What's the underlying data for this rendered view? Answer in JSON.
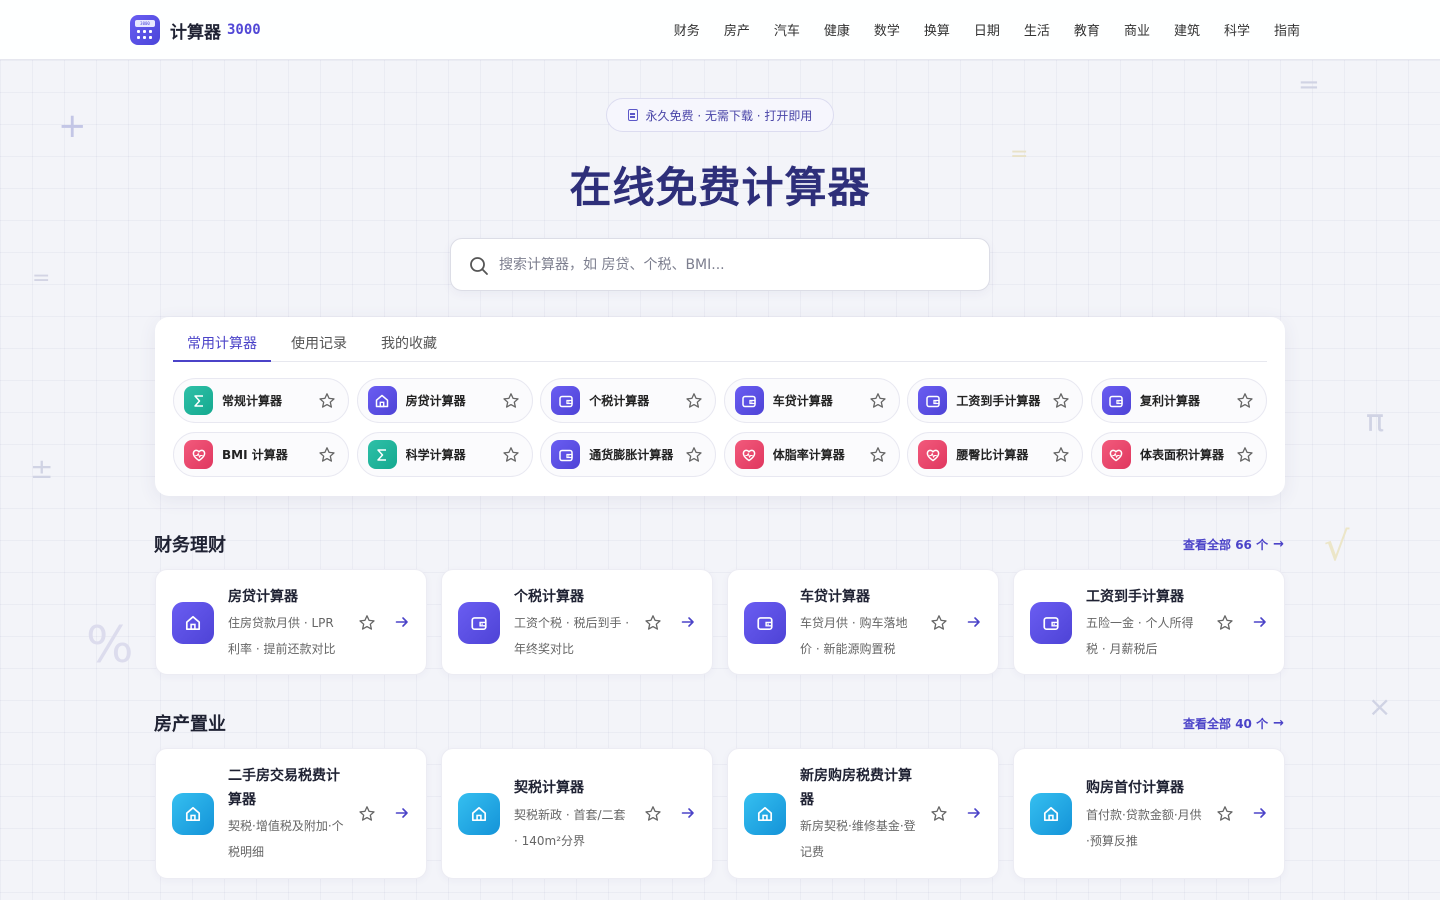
{
  "brand": {
    "title": "计算器",
    "number": "3000",
    "screen_text": "3000"
  },
  "nav": [
    "财务",
    "房产",
    "汽车",
    "健康",
    "数学",
    "换算",
    "日期",
    "生活",
    "教育",
    "商业",
    "建筑",
    "科学",
    "指南"
  ],
  "hero": {
    "badge": "永久免费 · 无需下载 · 打开即用",
    "title": "在线免费计算器",
    "search_placeholder": "搜索计算器，如 房贷、个税、BMI..."
  },
  "tabs": [
    "常用计算器",
    "使用记录",
    "我的收藏"
  ],
  "quick": [
    {
      "label": "常规计算器",
      "icon": "sigma-icon",
      "color": "teal"
    },
    {
      "label": "房贷计算器",
      "icon": "house-icon",
      "color": "purple"
    },
    {
      "label": "个税计算器",
      "icon": "wallet-icon",
      "color": "purple"
    },
    {
      "label": "车贷计算器",
      "icon": "wallet-icon",
      "color": "purple"
    },
    {
      "label": "工资到手计算器",
      "icon": "wallet-icon",
      "color": "purple"
    },
    {
      "label": "复利计算器",
      "icon": "wallet-icon",
      "color": "purple"
    },
    {
      "label": "BMI 计算器",
      "icon": "heart-icon",
      "color": "pink"
    },
    {
      "label": "科学计算器",
      "icon": "sigma-icon",
      "color": "teal"
    },
    {
      "label": "通货膨胀计算器",
      "icon": "wallet-icon",
      "color": "purple"
    },
    {
      "label": "体脂率计算器",
      "icon": "heart-icon",
      "color": "pink"
    },
    {
      "label": "腰臀比计算器",
      "icon": "heart-icon",
      "color": "pink"
    },
    {
      "label": "体表面积计算器",
      "icon": "heart-icon",
      "color": "pink"
    }
  ],
  "sections": [
    {
      "title": "财务理财",
      "more": "查看全部 66 个",
      "cards": [
        {
          "title": "房贷计算器",
          "desc": "住房贷款月供 · LPR 利率 · 提前还款对比",
          "icon": "house-icon",
          "color": "purple"
        },
        {
          "title": "个税计算器",
          "desc": "工资个税 · 税后到手 · 年终奖对比",
          "icon": "wallet-icon",
          "color": "purple"
        },
        {
          "title": "车贷计算器",
          "desc": "车贷月供 · 购车落地价 · 新能源购置税",
          "icon": "wallet-icon",
          "color": "purple"
        },
        {
          "title": "工资到手计算器",
          "desc": "五险一金 · 个人所得税 · 月薪税后",
          "icon": "wallet-icon",
          "color": "purple"
        }
      ]
    },
    {
      "title": "房产置业",
      "more": "查看全部 40 个",
      "cards": [
        {
          "title": "二手房交易税费计算器",
          "desc": "契税·增值税及附加·个税明细",
          "icon": "house-icon",
          "color": "blue"
        },
        {
          "title": "契税计算器",
          "desc": "契税新政 · 首套/二套 · 140m²分界",
          "icon": "house-icon",
          "color": "blue"
        },
        {
          "title": "新房购房税费计算器",
          "desc": "新房契税·维修基金·登记费",
          "icon": "house-icon",
          "color": "blue"
        },
        {
          "title": "购房首付计算器",
          "desc": "首付款·贷款金额·月供·预算反推",
          "icon": "house-icon",
          "color": "blue"
        }
      ]
    }
  ],
  "colors": {
    "accent": "#4b43c8",
    "title": "#2e2f7a",
    "teal": "#14a98f",
    "purple": "#5147d6",
    "pink": "#e0375f",
    "blue": "#1493d8"
  }
}
